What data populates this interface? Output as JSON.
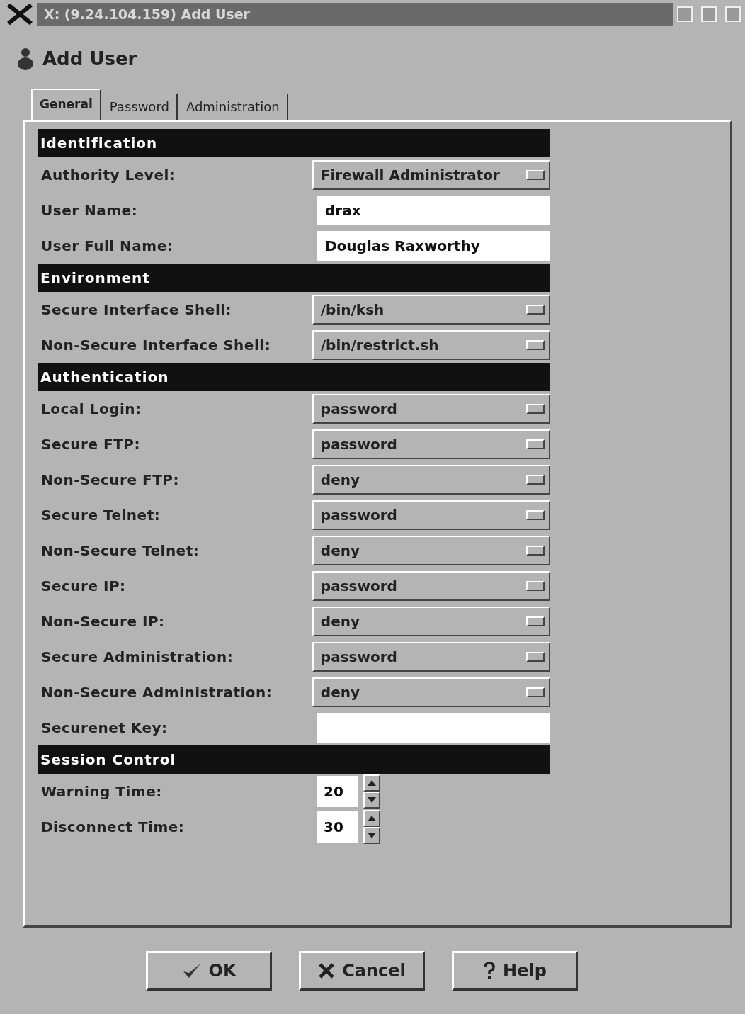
{
  "window": {
    "title": "X: (9.24.104.159) Add User"
  },
  "header": {
    "title": "Add User"
  },
  "tabs": [
    {
      "label": "General",
      "selected": true
    },
    {
      "label": "Password",
      "selected": false
    },
    {
      "label": "Administration",
      "selected": false
    }
  ],
  "sections": [
    {
      "title": "Identification",
      "fields": [
        {
          "kind": "select",
          "label": "Authority Level:",
          "value": "Firewall Administrator"
        },
        {
          "kind": "text",
          "label": "User Name:",
          "value": "drax"
        },
        {
          "kind": "text",
          "label": "User Full Name:",
          "value": "Douglas Raxworthy"
        }
      ]
    },
    {
      "title": "Environment",
      "fields": [
        {
          "kind": "select",
          "label": "Secure Interface Shell:",
          "value": "/bin/ksh"
        },
        {
          "kind": "select",
          "label": "Non-Secure Interface Shell:",
          "value": "/bin/restrict.sh"
        }
      ]
    },
    {
      "title": "Authentication",
      "fields": [
        {
          "kind": "select",
          "label": "Local Login:",
          "value": "password"
        },
        {
          "kind": "select",
          "label": "Secure FTP:",
          "value": "password"
        },
        {
          "kind": "select",
          "label": "Non-Secure FTP:",
          "value": "deny"
        },
        {
          "kind": "select",
          "label": "Secure Telnet:",
          "value": "password"
        },
        {
          "kind": "select",
          "label": "Non-Secure Telnet:",
          "value": "deny"
        },
        {
          "kind": "select",
          "label": "Secure IP:",
          "value": "password"
        },
        {
          "kind": "select",
          "label": "Non-Secure IP:",
          "value": "deny"
        },
        {
          "kind": "select",
          "label": "Secure Administration:",
          "value": "password"
        },
        {
          "kind": "select",
          "label": "Non-Secure Administration:",
          "value": "deny"
        },
        {
          "kind": "text",
          "label": "Securenet Key:"
        }
      ]
    },
    {
      "title": "Session Control",
      "fields": [
        {
          "kind": "spin",
          "label": "Warning Time:",
          "value": "20"
        },
        {
          "kind": "spin",
          "label": "Disconnect Time:",
          "value": "30"
        }
      ]
    }
  ],
  "buttons": [
    {
      "kind": "ok",
      "label": "OK"
    },
    {
      "kind": "cancel",
      "label": "Cancel"
    },
    {
      "kind": "help",
      "label": "Help"
    }
  ]
}
